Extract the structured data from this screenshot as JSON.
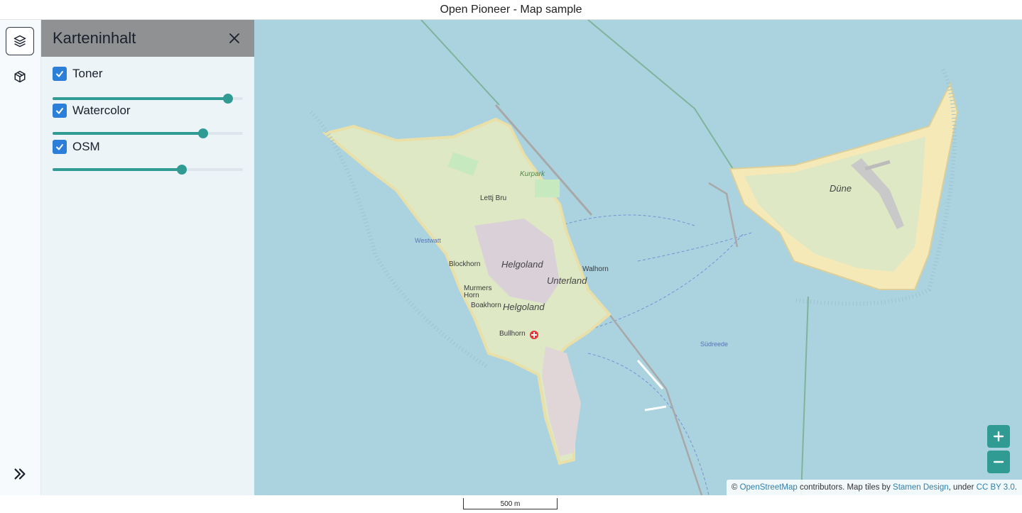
{
  "window": {
    "title": "Open Pioneer - Map sample"
  },
  "toolbar": {
    "items": [
      {
        "name": "layers",
        "icon": "layers-icon",
        "active": true
      },
      {
        "name": "cube",
        "icon": "cube-icon",
        "active": false
      },
      {
        "name": "expand",
        "icon": "chevrons-right-icon",
        "active": false
      }
    ]
  },
  "panel": {
    "title": "Karteninhalt",
    "layers": [
      {
        "label": "Toner",
        "checked": true,
        "opacity": 0.92
      },
      {
        "label": "Watercolor",
        "checked": true,
        "opacity": 0.79
      },
      {
        "label": "OSM",
        "checked": true,
        "opacity": 0.68
      }
    ]
  },
  "map": {
    "labels": {
      "helgoland_town": "Helgoland",
      "helgoland_island": "Helgoland",
      "unterland": "Unterland",
      "duene": "Düne",
      "westwatt": "Westwatt",
      "suedreede": "Südreede",
      "walhorn": "Walhorn",
      "bullhorn": "Bullhorn",
      "blockhorn": "Blockhorn",
      "murmers_horn": "Murmers Horn",
      "boakhorn": "Boakhorn",
      "lettj_bru": "Lettj Bru",
      "kurpark": "Kurpark"
    },
    "attribution": {
      "prefix": "©",
      "osm": "OpenStreetMap",
      "middle": "contributors. Map tiles by",
      "stamen": "Stamen Design",
      "under": ", under",
      "license": "CC BY 3.0",
      "suffix": "."
    },
    "scale": "500 m",
    "colors": {
      "water": "#aad3df",
      "land": "#dfe8c4",
      "beach": "#f5e9b8",
      "accent": "#2f9b92"
    }
  }
}
